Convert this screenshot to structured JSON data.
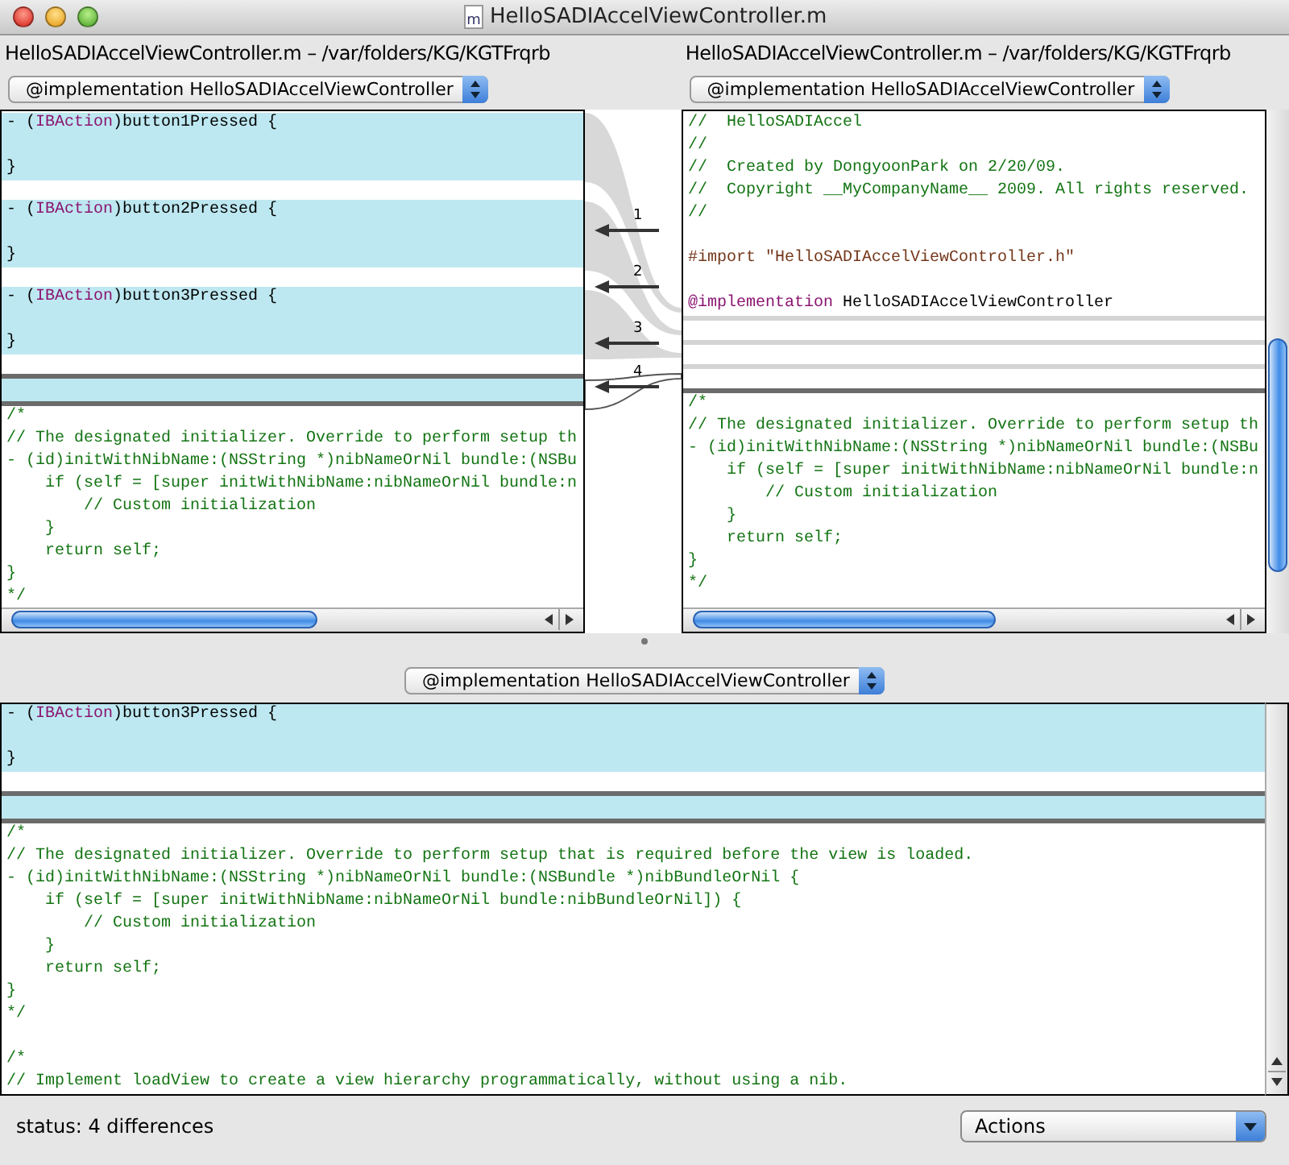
{
  "window": {
    "title": "HelloSADIAccelViewController.m",
    "icon_letter": "m"
  },
  "left_path": "HelloSADIAccelViewController.m – /var/folders/KG/KGTFrqrb",
  "right_path": "HelloSADIAccelViewController.m – /var/folders/KG/KGTFrqrb",
  "left_popup": "@implementation HelloSADIAccelViewController",
  "right_popup": "@implementation HelloSADIAccelViewController",
  "left_pane": {
    "lines": [
      {
        "kind": "code",
        "diff": true,
        "spans": [
          {
            "text": "- (",
            "color": "#000000"
          },
          {
            "text": "IBAction",
            "color": "#8a1470"
          },
          {
            "text": ")button1Pressed {",
            "color": "#000000"
          }
        ]
      },
      {
        "kind": "code",
        "diff": true
      },
      {
        "kind": "code",
        "diff": true,
        "spans": [
          {
            "text": "}",
            "color": "#000000"
          }
        ]
      },
      {
        "kind": "gap"
      },
      {
        "kind": "code",
        "diff": true,
        "spans": [
          {
            "text": "- (",
            "color": "#000000"
          },
          {
            "text": "IBAction",
            "color": "#8a1470"
          },
          {
            "text": ")button2Pressed {",
            "color": "#000000"
          }
        ]
      },
      {
        "kind": "code",
        "diff": true
      },
      {
        "kind": "code",
        "diff": true,
        "spans": [
          {
            "text": "}",
            "color": "#000000"
          }
        ]
      },
      {
        "kind": "gap"
      },
      {
        "kind": "code",
        "diff": true,
        "spans": [
          {
            "text": "- (",
            "color": "#000000"
          },
          {
            "text": "IBAction",
            "color": "#8a1470"
          },
          {
            "text": ")button3Pressed {",
            "color": "#000000"
          }
        ]
      },
      {
        "kind": "code",
        "diff": true
      },
      {
        "kind": "code",
        "diff": true,
        "spans": [
          {
            "text": "}",
            "color": "#000000"
          }
        ]
      },
      {
        "kind": "gap"
      },
      {
        "kind": "marker",
        "selected": true
      },
      {
        "kind": "code",
        "diff": true
      },
      {
        "kind": "marker",
        "selected": true
      },
      {
        "kind": "code",
        "diff": false,
        "spans": [
          {
            "text": "/*",
            "color": "#137413"
          }
        ]
      },
      {
        "kind": "code",
        "diff": false,
        "spans": [
          {
            "text": "// The designated initializer. Override to perform setup th",
            "color": "#137413"
          }
        ]
      },
      {
        "kind": "code",
        "diff": false,
        "spans": [
          {
            "text": "- (id)initWithNibName:(NSString *)nibNameOrNil bundle:(NSBu",
            "color": "#137413"
          }
        ]
      },
      {
        "kind": "code",
        "diff": false,
        "spans": [
          {
            "text": "    if (self = [super initWithNibName:nibNameOrNil bundle:n",
            "color": "#137413"
          }
        ]
      },
      {
        "kind": "code",
        "diff": false,
        "spans": [
          {
            "text": "        // Custom initialization",
            "color": "#137413"
          }
        ]
      },
      {
        "kind": "code",
        "diff": false,
        "spans": [
          {
            "text": "    }",
            "color": "#137413"
          }
        ]
      },
      {
        "kind": "code",
        "diff": false,
        "spans": [
          {
            "text": "    return self;",
            "color": "#137413"
          }
        ]
      },
      {
        "kind": "code",
        "diff": false,
        "spans": [
          {
            "text": "}",
            "color": "#137413"
          }
        ]
      },
      {
        "kind": "code",
        "diff": false,
        "spans": [
          {
            "text": "*/",
            "color": "#137413"
          }
        ]
      }
    ]
  },
  "right_pane": {
    "lines": [
      {
        "kind": "code",
        "diff": false,
        "spans": [
          {
            "text": "//  HelloSADIAccel",
            "color": "#137413"
          }
        ]
      },
      {
        "kind": "code",
        "diff": false,
        "spans": [
          {
            "text": "//",
            "color": "#137413"
          }
        ]
      },
      {
        "kind": "code",
        "diff": false,
        "spans": [
          {
            "text": "//  Created by DongyoonPark on 2/20/09.",
            "color": "#137413"
          }
        ]
      },
      {
        "kind": "code",
        "diff": false,
        "spans": [
          {
            "text": "//  Copyright __MyCompanyName__ 2009. All rights reserved.",
            "color": "#137413"
          }
        ]
      },
      {
        "kind": "code",
        "diff": false,
        "spans": [
          {
            "text": "//",
            "color": "#137413"
          }
        ]
      },
      {
        "kind": "code",
        "diff": false
      },
      {
        "kind": "code",
        "diff": false,
        "spans": [
          {
            "text": "#import \"HelloSADIAccelViewController.h\"",
            "color": "#74371a"
          }
        ]
      },
      {
        "kind": "code",
        "diff": false
      },
      {
        "kind": "code",
        "diff": false,
        "spans": [
          {
            "text": "@implementation",
            "color": "#8a1470"
          },
          {
            "text": " HelloSADIAccelViewController",
            "color": "#000000"
          }
        ]
      },
      {
        "kind": "marker",
        "selected": false
      },
      {
        "kind": "gap"
      },
      {
        "kind": "marker",
        "selected": false
      },
      {
        "kind": "gap"
      },
      {
        "kind": "marker",
        "selected": false
      },
      {
        "kind": "gap"
      },
      {
        "kind": "marker",
        "selected": true
      },
      {
        "kind": "code",
        "diff": false,
        "spans": [
          {
            "text": "/*",
            "color": "#137413"
          }
        ]
      },
      {
        "kind": "code",
        "diff": false,
        "spans": [
          {
            "text": "// The designated initializer. Override to perform setup th",
            "color": "#137413"
          }
        ]
      },
      {
        "kind": "code",
        "diff": false,
        "spans": [
          {
            "text": "- (id)initWithNibName:(NSString *)nibNameOrNil bundle:(NSBu",
            "color": "#137413"
          }
        ]
      },
      {
        "kind": "code",
        "diff": false,
        "spans": [
          {
            "text": "    if (self = [super initWithNibName:nibNameOrNil bundle:n",
            "color": "#137413"
          }
        ]
      },
      {
        "kind": "code",
        "diff": false,
        "spans": [
          {
            "text": "        // Custom initialization",
            "color": "#137413"
          }
        ]
      },
      {
        "kind": "code",
        "diff": false,
        "spans": [
          {
            "text": "    }",
            "color": "#137413"
          }
        ]
      },
      {
        "kind": "code",
        "diff": false,
        "spans": [
          {
            "text": "    return self;",
            "color": "#137413"
          }
        ]
      },
      {
        "kind": "code",
        "diff": false,
        "spans": [
          {
            "text": "}",
            "color": "#137413"
          }
        ]
      },
      {
        "kind": "code",
        "diff": false,
        "spans": [
          {
            "text": "*/",
            "color": "#137413"
          }
        ]
      }
    ]
  },
  "differences": [
    {
      "number": "1",
      "selected": false
    },
    {
      "number": "2",
      "selected": false
    },
    {
      "number": "3",
      "selected": false
    },
    {
      "number": "4",
      "selected": true
    }
  ],
  "merge_popup": "@implementation HelloSADIAccelViewController",
  "merge_pane": {
    "lines": [
      {
        "kind": "code",
        "diff": true,
        "spans": [
          {
            "text": "- (",
            "color": "#000000"
          },
          {
            "text": "IBAction",
            "color": "#8a1470"
          },
          {
            "text": ")button3Pressed {",
            "color": "#000000"
          }
        ]
      },
      {
        "kind": "code",
        "diff": true
      },
      {
        "kind": "code",
        "diff": true,
        "spans": [
          {
            "text": "}",
            "color": "#000000"
          }
        ]
      },
      {
        "kind": "gap"
      },
      {
        "kind": "marker",
        "selected": true
      },
      {
        "kind": "code",
        "diff": true
      },
      {
        "kind": "marker",
        "selected": true
      },
      {
        "kind": "code",
        "diff": false,
        "spans": [
          {
            "text": "/*",
            "color": "#137413"
          }
        ]
      },
      {
        "kind": "code",
        "diff": false,
        "spans": [
          {
            "text": "// The designated initializer. Override to perform setup that is required before the view is loaded.",
            "color": "#137413"
          }
        ]
      },
      {
        "kind": "code",
        "diff": false,
        "spans": [
          {
            "text": "- (id)initWithNibName:(NSString *)nibNameOrNil bundle:(NSBundle *)nibBundleOrNil {",
            "color": "#137413"
          }
        ]
      },
      {
        "kind": "code",
        "diff": false,
        "spans": [
          {
            "text": "    if (self = [super initWithNibName:nibNameOrNil bundle:nibBundleOrNil]) {",
            "color": "#137413"
          }
        ]
      },
      {
        "kind": "code",
        "diff": false,
        "spans": [
          {
            "text": "        // Custom initialization",
            "color": "#137413"
          }
        ]
      },
      {
        "kind": "code",
        "diff": false,
        "spans": [
          {
            "text": "    }",
            "color": "#137413"
          }
        ]
      },
      {
        "kind": "code",
        "diff": false,
        "spans": [
          {
            "text": "    return self;",
            "color": "#137413"
          }
        ]
      },
      {
        "kind": "code",
        "diff": false,
        "spans": [
          {
            "text": "}",
            "color": "#137413"
          }
        ]
      },
      {
        "kind": "code",
        "diff": false,
        "spans": [
          {
            "text": "*/",
            "color": "#137413"
          }
        ]
      },
      {
        "kind": "code",
        "diff": false
      },
      {
        "kind": "code",
        "diff": false,
        "spans": [
          {
            "text": "/*",
            "color": "#137413"
          }
        ]
      },
      {
        "kind": "code",
        "diff": false,
        "spans": [
          {
            "text": "// Implement loadView to create a view hierarchy programmatically, without using a nib.",
            "color": "#137413"
          }
        ]
      }
    ]
  },
  "status": "status: 4 differences",
  "actions_popup": "Actions"
}
